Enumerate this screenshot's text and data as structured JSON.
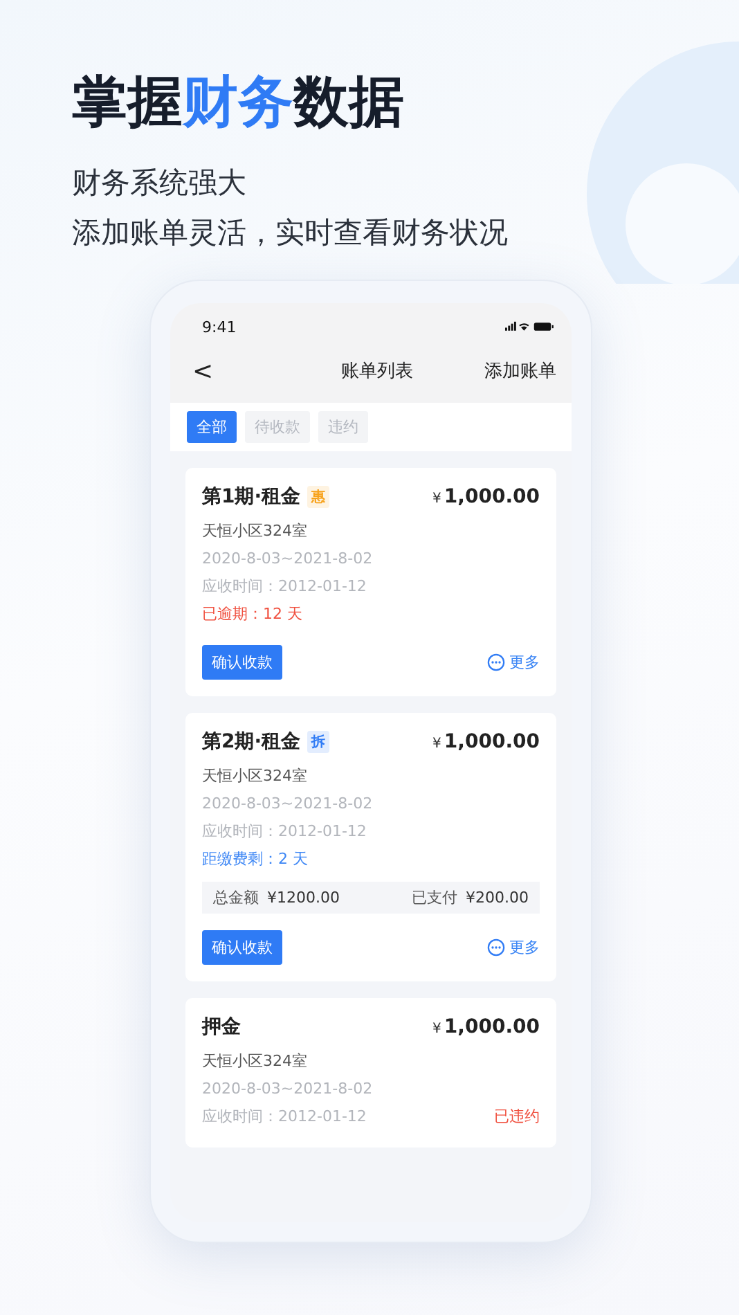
{
  "headline": [
    {
      "text": "掌握",
      "highlight": false
    },
    {
      "text": "财务",
      "highlight": true
    },
    {
      "text": "数据",
      "highlight": false
    }
  ],
  "subtitle": [
    "财务系统强大",
    "添加账单灵活，实时查看财务状况"
  ],
  "phone": {
    "status_bar": {
      "time": "9:41"
    },
    "nav": {
      "back": "<",
      "title": "账单列表",
      "action": "添加账单"
    },
    "filters": [
      {
        "label": "全部",
        "selected": true
      },
      {
        "label": "待收款",
        "selected": false
      },
      {
        "label": "违约",
        "selected": false
      }
    ],
    "cards": [
      {
        "title": "第1期·租金",
        "badge": {
          "text": "惠",
          "color": "#f7a21b"
        },
        "currency": "¥",
        "amount": "1,000.00",
        "address": "天恒小区324室",
        "period": "2020-8-03~2021-8-02",
        "due": "应收时间：2012-01-12",
        "status": {
          "text": "已逾期：12 天",
          "color": "#f0503f",
          "kind": "line"
        },
        "actions": {
          "confirm": "确认收款",
          "more": "更多"
        }
      },
      {
        "title": "第2期·租金",
        "badge": {
          "text": "拆",
          "color": "#2f7bf5"
        },
        "currency": "¥",
        "amount": "1,000.00",
        "address": "天恒小区324室",
        "period": "2020-8-03~2021-8-02",
        "due": "应收时间：2012-01-12",
        "status": {
          "text": "距缴费剩：2 天",
          "color": "#3c86f5",
          "kind": "line"
        },
        "summary": {
          "total_label": "总金额",
          "total": "¥1200.00",
          "paid_label": "已支付",
          "paid": "¥200.00"
        },
        "actions": {
          "confirm": "确认收款",
          "more": "更多"
        }
      },
      {
        "title": "押金",
        "currency": "¥",
        "amount": "1,000.00",
        "address": "天恒小区324室",
        "period": "2020-8-03~2021-8-02",
        "due": "应收时间：2012-01-12",
        "status": {
          "text": "已违约",
          "color": "#f0503f",
          "kind": "inline"
        }
      }
    ]
  }
}
